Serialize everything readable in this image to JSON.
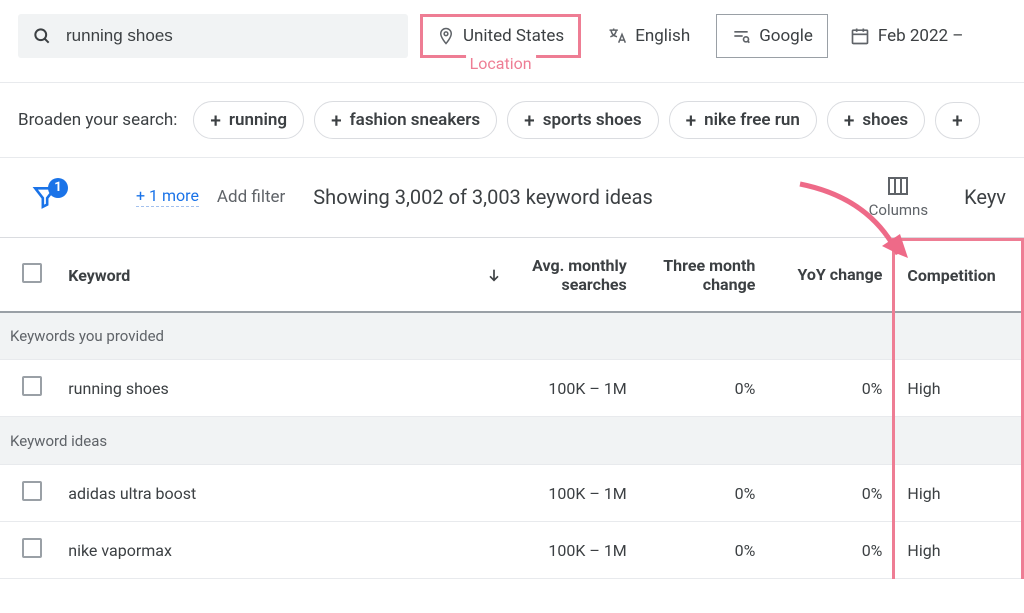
{
  "toolbar": {
    "search_value": "running shoes",
    "location_label": "United States",
    "annotation_location": "Location",
    "language_label": "English",
    "network_label": "Google",
    "date_label": "Feb 2022 –"
  },
  "broaden": {
    "label": "Broaden your search:",
    "pills": [
      "running",
      "fashion sneakers",
      "sports shoes",
      "nike free run",
      "shoes"
    ]
  },
  "filters": {
    "badge": "1",
    "more_link": "+ 1 more",
    "add_filter": "Add filter",
    "showing_text": "Showing 3,002 of 3,003 keyword ideas",
    "columns_label": "Columns",
    "keyw_cut": "Keyv"
  },
  "table": {
    "headers": {
      "keyword": "Keyword",
      "avg1": "Avg. monthly",
      "avg2": "searches",
      "three1": "Three month",
      "three2": "change",
      "yoy": "YoY change",
      "comp": "Competition"
    },
    "section1": "Keywords you provided",
    "section2": "Keyword ideas",
    "rows_provided": [
      {
        "keyword": "running shoes",
        "avg": "100K – 1M",
        "three": "0%",
        "yoy": "0%",
        "comp": "High"
      }
    ],
    "rows_ideas": [
      {
        "keyword": "adidas ultra boost",
        "avg": "100K – 1M",
        "three": "0%",
        "yoy": "0%",
        "comp": "High"
      },
      {
        "keyword": "nike vapormax",
        "avg": "100K – 1M",
        "three": "0%",
        "yoy": "0%",
        "comp": "High"
      }
    ]
  }
}
